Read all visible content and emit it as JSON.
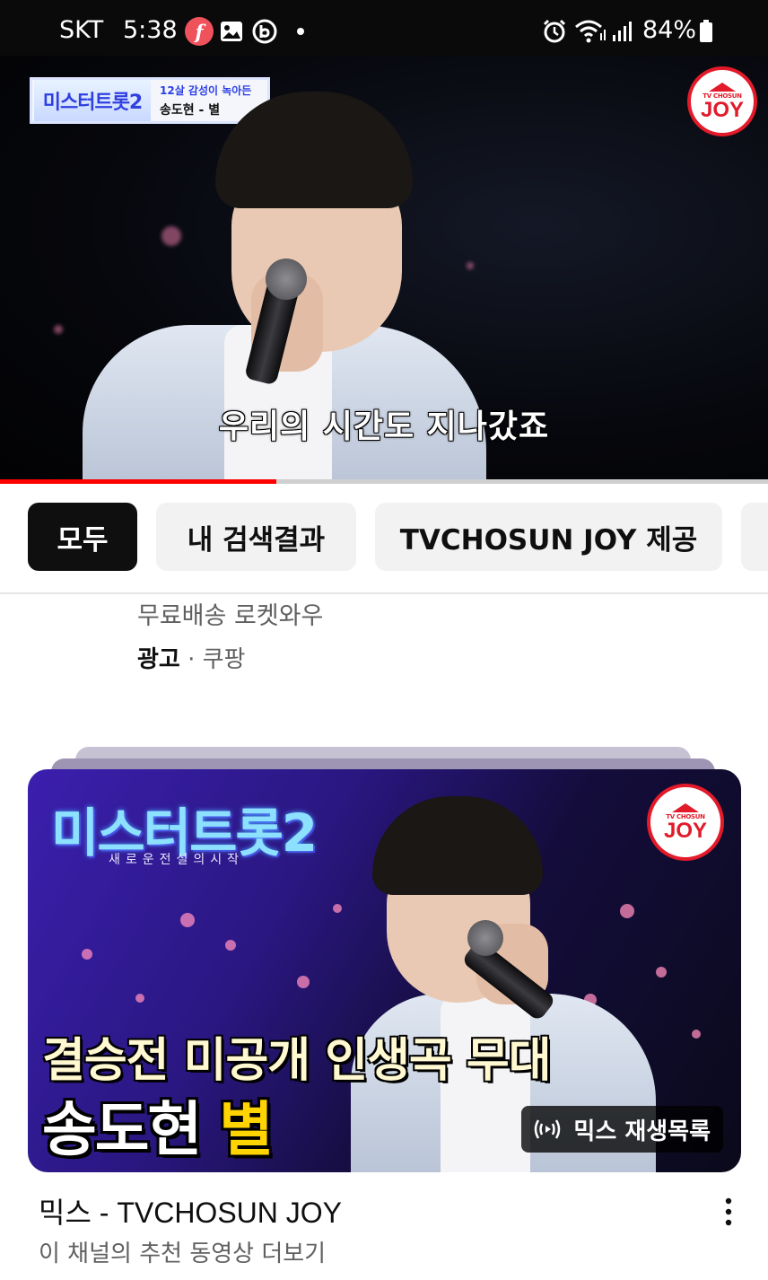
{
  "status_bar": {
    "carrier": "SKT",
    "time": "5:38",
    "battery": "84%",
    "icons": [
      "f-app-icon",
      "gallery-icon",
      "b-app-icon",
      "dot-icon",
      "alarm-icon",
      "wifi-icon",
      "signal-icon",
      "battery-icon"
    ]
  },
  "video": {
    "banner_logo": "미스터트롯2",
    "banner_line1": "12살 감성이 녹아든",
    "banner_line2": "송도현 - 별",
    "channel_badge_small": "TV CHOSUN",
    "channel_badge": "JOY",
    "subtitle": "우리의 시간도 지나갔죠",
    "progress": 0.36,
    "progress_color": "#ff0000"
  },
  "chips": [
    {
      "label": "모두",
      "active": true
    },
    {
      "label": "내 검색결과",
      "active": false
    },
    {
      "label": "TVCHOSUN JOY 제공",
      "active": false
    }
  ],
  "ad": {
    "subtitle": "무료배송 로켓와우",
    "label": "광고",
    "separator": "·",
    "advertiser": "쿠팡"
  },
  "mix": {
    "thumb_logo": "미스터트롯2",
    "thumb_tagline": "새로운전설의시작",
    "thumb_badge_small": "TV CHOSUN",
    "thumb_badge": "JOY",
    "caption_line1": "결승전 미공개 인생곡 무대",
    "caption_name": "송도현",
    "caption_song": "별",
    "badge_label": "믹스 재생목록",
    "title": "믹스 - TVCHOSUN JOY",
    "subtitle": "이 채널의 추천 동영상 더보기"
  }
}
